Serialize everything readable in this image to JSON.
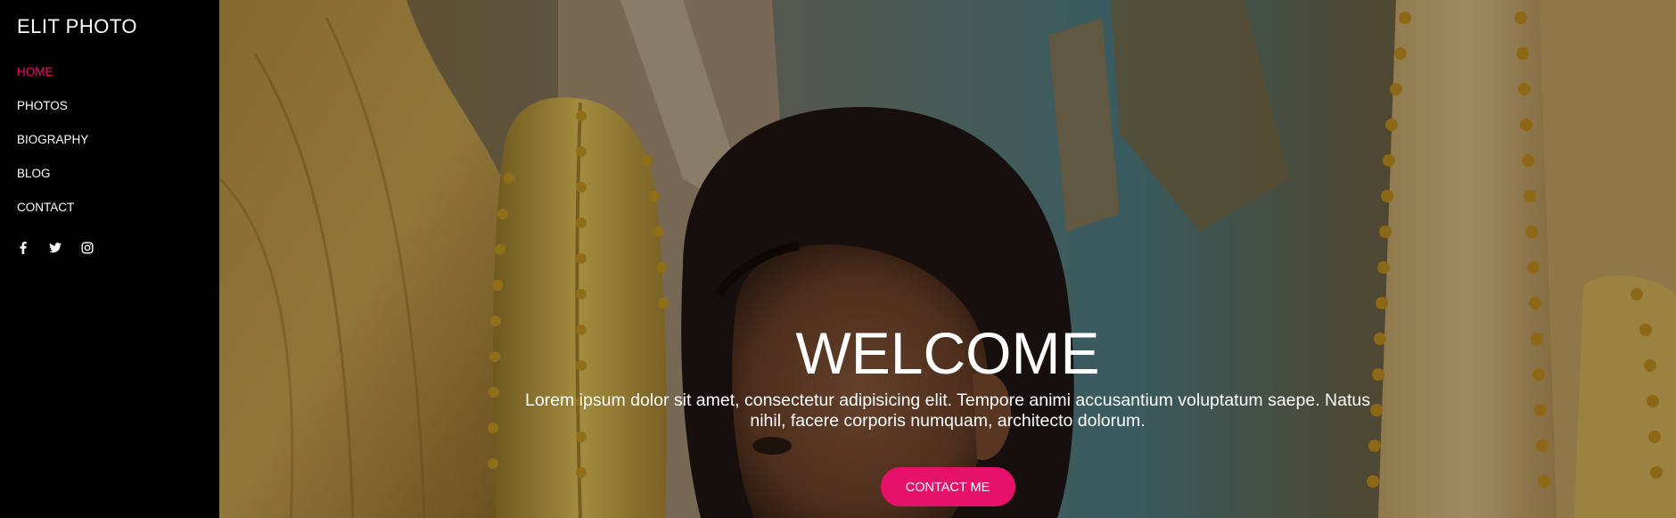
{
  "brand": "ELIT PHOTO",
  "nav": {
    "items": [
      {
        "label": "HOME",
        "active": true
      },
      {
        "label": "PHOTOS",
        "active": false
      },
      {
        "label": "BIOGRAPHY",
        "active": false
      },
      {
        "label": "BLOG",
        "active": false
      },
      {
        "label": "CONTACT",
        "active": false
      }
    ]
  },
  "social": {
    "icons": [
      "facebook-icon",
      "twitter-icon",
      "instagram-icon"
    ]
  },
  "hero": {
    "title": "WELCOME",
    "text": "Lorem ipsum dolor sit amet, consectetur adipisicing elit. Tempore animi accusantium voluptatum saepe. Natus nihil, facere corporis numquam, architecto dolorum.",
    "button_label": "CONTACT ME"
  },
  "colors": {
    "accent": "#e5116b",
    "sidebar_bg": "#000000",
    "text": "#ffffff"
  }
}
